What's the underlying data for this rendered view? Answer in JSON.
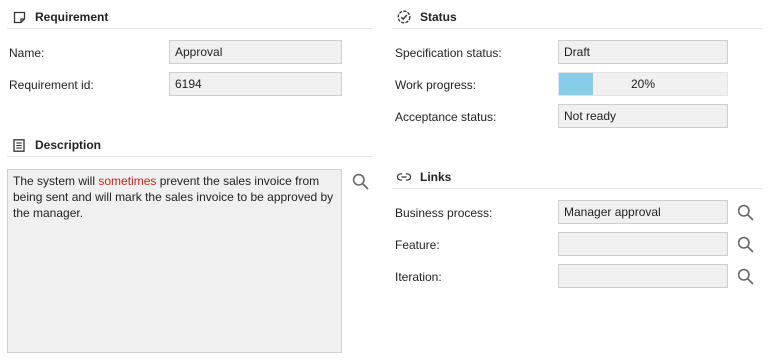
{
  "requirement": {
    "header": "Requirement",
    "name_label": "Name:",
    "name_value": "Approval",
    "id_label": "Requirement id:",
    "id_value": "6194"
  },
  "description": {
    "header": "Description",
    "text_before": "The system will ",
    "text_highlight": "sometimes",
    "text_after": " prevent the sales invoice from being sent and will mark the sales invoice to be approved by the manager."
  },
  "status": {
    "header": "Status",
    "spec_label": "Specification status:",
    "spec_value": "Draft",
    "progress_label": "Work progress:",
    "progress_value": 0.2,
    "progress_text": "20%",
    "acceptance_label": "Acceptance status:",
    "acceptance_value": "Not ready"
  },
  "links": {
    "header": "Links",
    "business_label": "Business process:",
    "business_value": "Manager approval",
    "feature_label": "Feature:",
    "feature_value": "",
    "iteration_label": "Iteration:",
    "iteration_value": ""
  },
  "icons": {
    "requirement": "note-icon",
    "description": "document-icon",
    "status": "check-circle-icon",
    "links": "link-icon",
    "search": "search-icon"
  },
  "colors": {
    "progress_fill": "#87cde9",
    "highlight_text": "#c0281c"
  }
}
